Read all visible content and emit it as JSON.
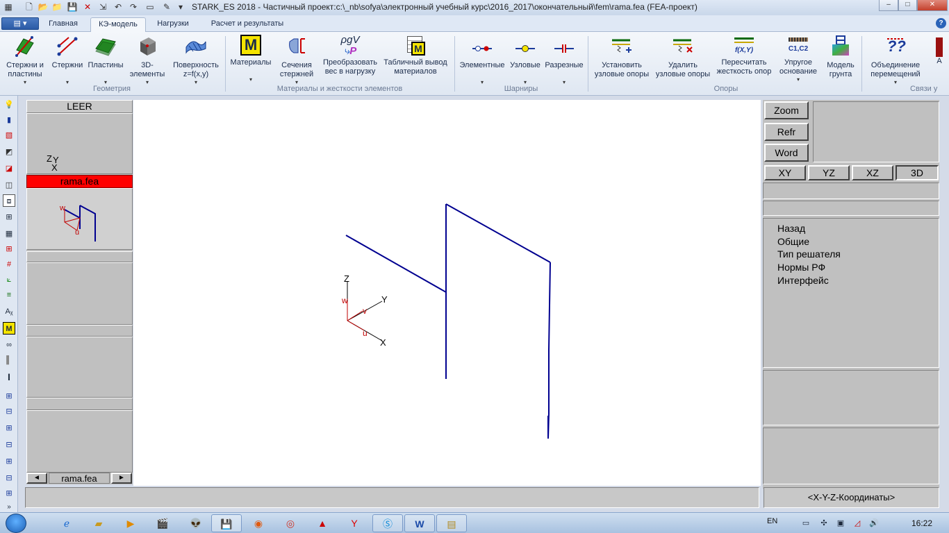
{
  "window": {
    "title": "STARK_ES 2018 - Частичный проект:c:\\_nb\\sofya\\электронный учебный курс\\2016_2017\\окончательный\\fem\\rama.fea  (FEA-проект)",
    "controls": [
      "–",
      "□",
      "✕"
    ]
  },
  "ribbon_tabs": [
    "Главная",
    "КЭ-модель",
    "Нагрузки",
    "Расчет и результаты"
  ],
  "active_tab": "КЭ-модель",
  "ribbon": {
    "buttons": [
      {
        "label1": "Стержни и",
        "label2": "пластины",
        "icon": "rods-plates-icon"
      },
      {
        "label1": "Стержни",
        "label2": "",
        "icon": "rods-icon"
      },
      {
        "label1": "Пластины",
        "label2": "",
        "icon": "plates-icon"
      },
      {
        "label1": "3D-",
        "label2": "элементы",
        "icon": "cube-icon"
      },
      {
        "label1": "Поверхность",
        "label2": "z=f(x,y)",
        "icon": "surface-icon"
      },
      {
        "label1": "Материалы",
        "label2": "",
        "icon": "materials-icon"
      },
      {
        "label1": "Сечения",
        "label2": "стержней",
        "icon": "sections-icon"
      },
      {
        "label1": "Преобразовать",
        "label2": "вес в нагрузку",
        "icon": "weight-to-load-icon"
      },
      {
        "label1": "Табличный вывод",
        "label2": "материалов",
        "icon": "table-materials-icon"
      },
      {
        "label1": "Элементные",
        "label2": "",
        "icon": "element-hinge-icon"
      },
      {
        "label1": "Узловые",
        "label2": "",
        "icon": "node-hinge-icon"
      },
      {
        "label1": "Разрезные",
        "label2": "",
        "icon": "split-hinge-icon"
      },
      {
        "label1": "Установить",
        "label2": "узловые опоры",
        "icon": "set-support-icon"
      },
      {
        "label1": "Удалить",
        "label2": "узловые опоры",
        "icon": "delete-support-icon"
      },
      {
        "label1": "Пересчитать",
        "label2": "жесткость опор",
        "icon": "recalc-stiffness-icon"
      },
      {
        "label1": "Упругое",
        "label2": "основание",
        "icon": "elastic-base-icon"
      },
      {
        "label1": "Модель",
        "label2": "грунта",
        "icon": "soil-model-icon"
      },
      {
        "label1": "Объединение",
        "label2": "перемещений",
        "icon": "merge-displacements-icon"
      },
      {
        "label1": "А",
        "label2": "",
        "icon": "more-icon"
      }
    ],
    "icon_text": {
      "materials": "M",
      "weight": "ρgV",
      "weight_p": "P",
      "recalc": "f(X,Y)",
      "elastic": "C1,C2"
    },
    "groups": [
      "Геометрия",
      "Материалы и жесткости элементов",
      "Шарниры",
      "Опоры",
      "Связи у"
    ]
  },
  "left_panel": {
    "header": "LEER",
    "axis_labels": {
      "z": "Z",
      "y": "Y",
      "x": "X"
    },
    "file_name": "rama.fea",
    "thumb_labels": {
      "w": "w",
      "u": "u"
    },
    "nav_file": "rama.fea",
    "nav_prev": "◄",
    "nav_next": "►"
  },
  "canvas": {
    "axis_labels": {
      "z": "Z",
      "y": "Y",
      "x": "X",
      "w": "w",
      "v": "v",
      "u": "u"
    }
  },
  "right_panel": {
    "buttons": [
      "Zoom",
      "Refr",
      "Word"
    ],
    "view_buttons": [
      "XY",
      "YZ",
      "XZ",
      "3D"
    ],
    "active_view": "3D",
    "menu": [
      "Назад",
      "Общие",
      "Тип решателя",
      "Нормы  РФ",
      "Интерфейс"
    ],
    "coords_button": "<X-Y-Z-Координаты>"
  },
  "taskbar": {
    "lang": "EN",
    "clock": "16:22"
  },
  "colors": {
    "frame": "#000090",
    "local_axes": "#c00000",
    "highlight": "#ff0000"
  }
}
